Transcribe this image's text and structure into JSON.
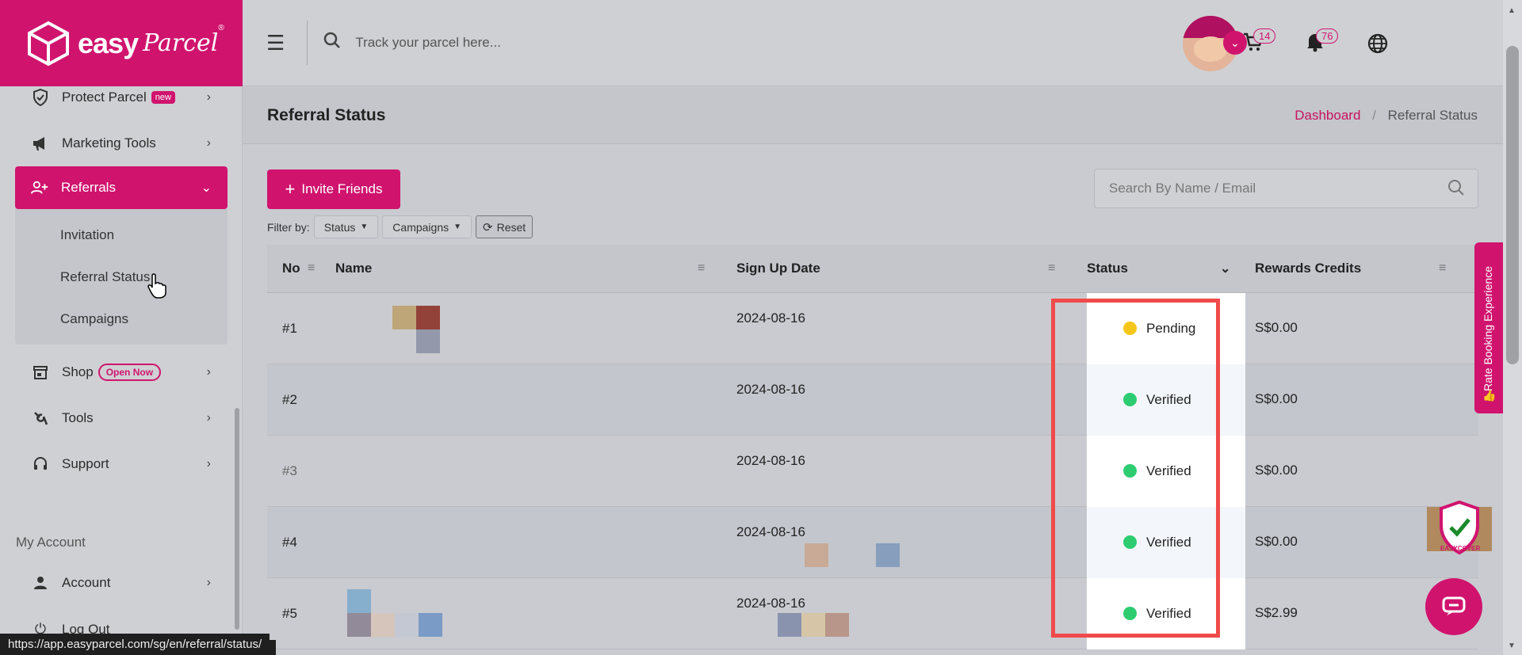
{
  "brand": {
    "easy": "easy",
    "parcel": "Parcel",
    "reg": "®"
  },
  "sidebar": {
    "items": [
      {
        "label": "Protect Parcel",
        "badge": "new"
      },
      {
        "label": "Marketing Tools"
      },
      {
        "label": "Referrals"
      },
      {
        "label": "Shop",
        "badge": "Open Now"
      },
      {
        "label": "Tools"
      },
      {
        "label": "Support"
      }
    ],
    "sub_items": [
      "Invitation",
      "Referral Status",
      "Campaigns"
    ],
    "section_label": "My Account",
    "account_items": [
      {
        "label": "Account"
      },
      {
        "label": "Log Out"
      }
    ]
  },
  "header": {
    "track_placeholder": "Track your parcel here...",
    "cart_count": "14",
    "notification_count": "76"
  },
  "page": {
    "title": "Referral Status",
    "breadcrumb": {
      "home": "Dashboard",
      "separator": "/",
      "current": "Referral Status"
    }
  },
  "controls": {
    "invite_label": "Invite Friends",
    "search_placeholder": "Search By Name / Email",
    "filter_label": "Filter by:",
    "filter_status": "Status",
    "filter_campaigns": "Campaigns",
    "reset_label": "Reset"
  },
  "table": {
    "columns": [
      "No",
      "Name",
      "Sign Up Date",
      "Status",
      "Rewards Credits"
    ],
    "rows": [
      {
        "no": "#1",
        "date": "2024-08-16",
        "status": "Pending",
        "credits": "S$0.00"
      },
      {
        "no": "#2",
        "date": "2024-08-16",
        "status": "Verified",
        "credits": "S$0.00"
      },
      {
        "no": "#3",
        "date": "2024-08-16",
        "status": "Verified",
        "credits": "S$0.00"
      },
      {
        "no": "#4",
        "date": "2024-08-16",
        "status": "Verified",
        "credits": "S$0.00"
      },
      {
        "no": "#5",
        "date": "2024-08-16",
        "status": "Verified",
        "credits": "S$2.99"
      }
    ]
  },
  "widgets": {
    "rate_label": "Rate Booking Experience",
    "easycover_label": "EASYCOVER"
  },
  "status_bar": {
    "url": "https://app.easyparcel.com/sg/en/referral/status/"
  },
  "colors": {
    "accent": "#d0146e",
    "pending": "#f5c518",
    "verified": "#2ecc71",
    "highlight": "#f04a4a"
  }
}
